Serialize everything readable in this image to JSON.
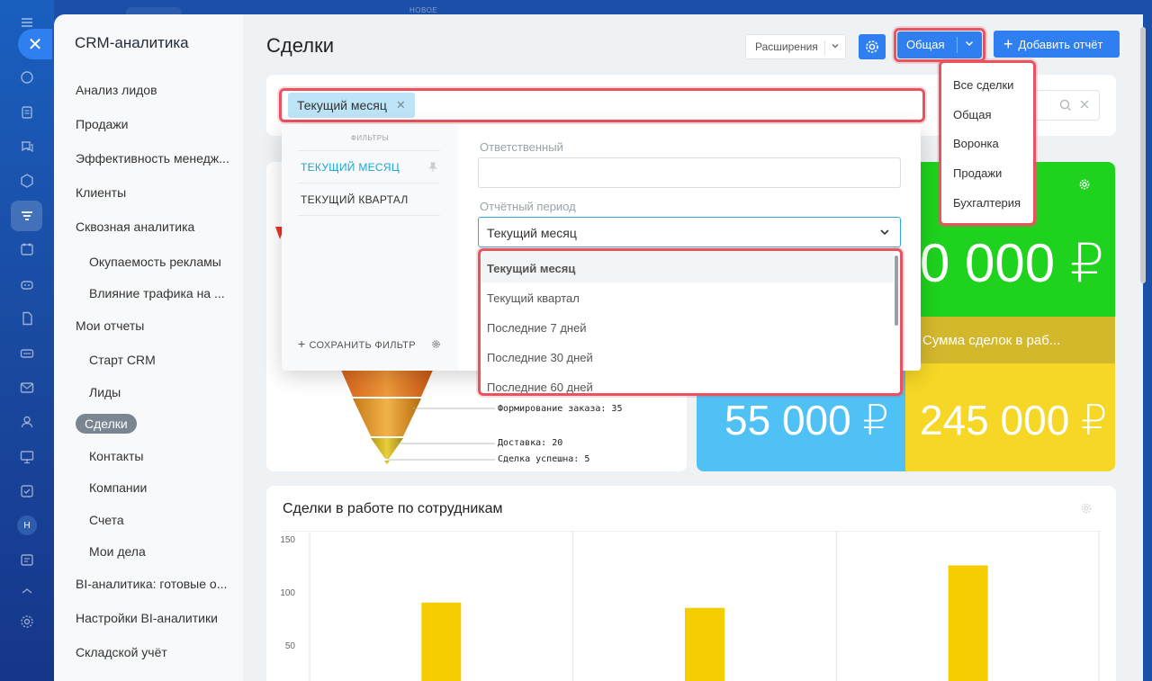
{
  "top": {
    "badge_new": "НОВОЕ"
  },
  "rail": {
    "avatar_letter": "Н"
  },
  "sidebar": {
    "title": "CRM-аналитика",
    "items": [
      {
        "label": "Анализ лидов",
        "sub": false
      },
      {
        "label": "Продажи",
        "sub": false
      },
      {
        "label": "Эффективность менедж...",
        "sub": false
      },
      {
        "label": "Клиенты",
        "sub": false
      },
      {
        "label": "Сквозная аналитика",
        "sub": false
      },
      {
        "label": "Окупаемость рекламы",
        "sub": true
      },
      {
        "label": "Влияние трафика на ...",
        "sub": true
      },
      {
        "label": "Мои отчеты",
        "sub": false
      },
      {
        "label": "Старт CRM",
        "sub": true
      },
      {
        "label": "Лиды",
        "sub": true
      },
      {
        "label": "Сделки",
        "sub": true,
        "active": true
      },
      {
        "label": "Контакты",
        "sub": true
      },
      {
        "label": "Компании",
        "sub": true
      },
      {
        "label": "Счета",
        "sub": true
      },
      {
        "label": "Мои дела",
        "sub": true
      },
      {
        "label": "BI-аналитика: готовые о...",
        "sub": false
      },
      {
        "label": "Настройки BI-аналитики",
        "sub": false
      },
      {
        "label": "Складской учёт",
        "sub": false
      }
    ]
  },
  "header": {
    "title": "Сделки",
    "extensions_label": "Расширения",
    "board_label": "Общая",
    "add_report_label": "Добавить отчёт"
  },
  "board_menu": {
    "items": [
      "Все сделки",
      "Общая",
      "Воронка",
      "Продажи",
      "Бухгалтерия"
    ]
  },
  "filter": {
    "tag": "Текущий месяц",
    "presets_header": "ФИЛЬТРЫ",
    "presets": [
      "ТЕКУЩИЙ МЕСЯЦ",
      "ТЕКУЩИЙ КВАРТАЛ"
    ],
    "save_label": "СОХРАНИТЬ ФИЛЬТР",
    "responsible_label": "Ответственный",
    "responsible_value": "",
    "period_label": "Отчётный период",
    "period_value": "Текущий месяц",
    "period_options": [
      "Текущий месяц",
      "Текущий квартал",
      "Последние 7 дней",
      "Последние 30 дней",
      "Последние 60 дней"
    ]
  },
  "funnel": {
    "labels": [
      {
        "text": "Формирование заказа: 35"
      },
      {
        "text": "Доставка: 20"
      },
      {
        "text": "Сделка успешна: 5"
      }
    ]
  },
  "tiles": {
    "top_value": "0 000 ₽",
    "mid_label": "Сумма сделок в раб...",
    "left_value": "55 000 ₽",
    "right_value": "245 000 ₽",
    "colors": {
      "green": "#1ed21e",
      "olive": "#d4b82c",
      "blue": "#4fc1f4",
      "yellow": "#f6d726"
    }
  },
  "chart": {
    "title": "Сделки в работе по сотрудникам"
  },
  "chart_data": {
    "type": "bar",
    "title": "Сделки в работе по сотрудникам",
    "categories": [
      "",
      "",
      ""
    ],
    "values": [
      90,
      85,
      125
    ],
    "yticks": [
      150,
      100,
      50
    ],
    "ylim": [
      0,
      150
    ],
    "color": "#f6cd00"
  }
}
